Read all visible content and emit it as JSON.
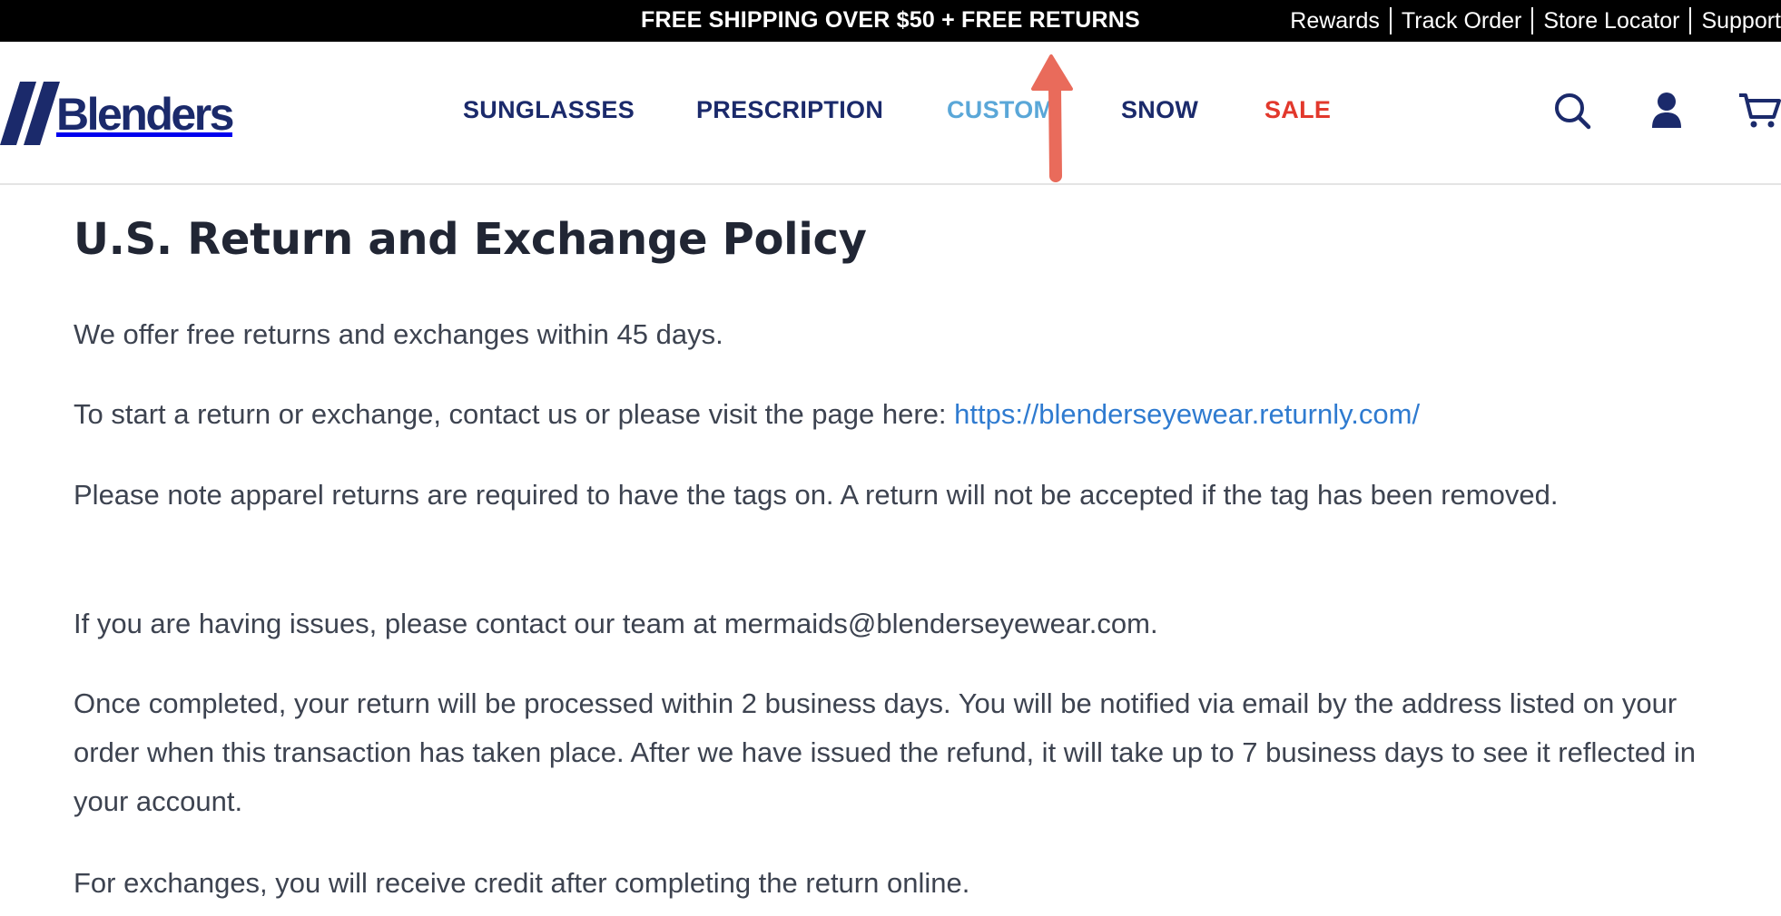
{
  "announcement": {
    "promo": "FREE SHIPPING OVER $50 + FREE RETURNS",
    "links": [
      "Rewards",
      "Track Order",
      "Store Locator",
      "Support"
    ]
  },
  "header": {
    "logo_text": "Blenders",
    "nav": {
      "sunglasses": "SUNGLASSES",
      "prescription": "PRESCRIPTION",
      "custom": "CUSTOM",
      "snow": "SNOW",
      "sale": "SALE"
    },
    "icons": [
      "search-icon",
      "account-icon",
      "cart-icon"
    ]
  },
  "colors": {
    "brand_navy": "#1b2a6b",
    "custom_blue": "#5aa7d8",
    "sale_red": "#e2382c",
    "link_blue": "#2f7bd0",
    "annotation_arrow": "#e96b5b"
  },
  "page": {
    "title": "U.S. Return and Exchange Policy",
    "p1": "We offer free returns and exchanges within 45 days.",
    "p2_text": "To start a return or exchange, contact us or please visit the page here: ",
    "p2_link": "https://blenderseyewear.returnly.com/",
    "p3": "Please note apparel returns are required to have the tags on. A return will not be accepted if the tag has been removed.",
    "p4": "If you are having issues, please contact our team at mermaids@blenderseyewear.com.",
    "p5": "Once completed, your return will be processed within 2 business days. You will be notified via email by the address listed on your order when this transaction has taken place. After we have issued the refund, it will take up to 7 business days to see it reflected in your account.",
    "p6": "For exchanges, you will receive credit after completing the return online."
  }
}
